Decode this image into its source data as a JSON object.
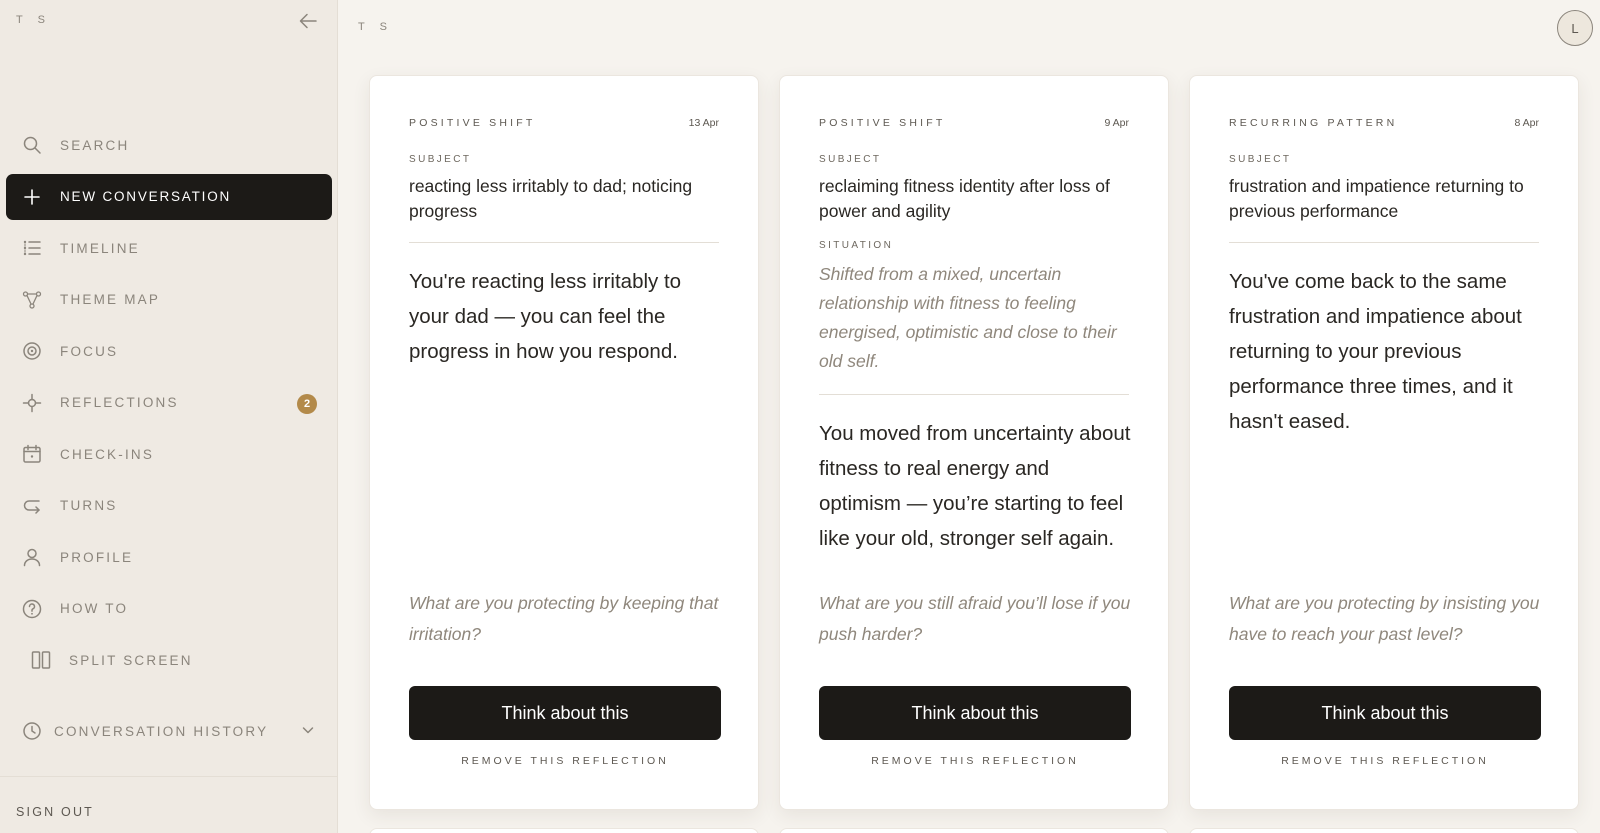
{
  "sidebar": {
    "brand": "T S",
    "collapse_icon": "arrow-left-icon",
    "items": [
      {
        "label": "SEARCH",
        "icon": "search-icon"
      },
      {
        "label": "NEW CONVERSATION",
        "icon": "plus-icon",
        "active": true
      },
      {
        "label": "TIMELINE",
        "icon": "list-icon"
      },
      {
        "label": "THEME MAP",
        "icon": "network-icon"
      },
      {
        "label": "FOCUS",
        "icon": "target-icon"
      },
      {
        "label": "REFLECTIONS",
        "icon": "crosshair-icon",
        "badge": "2"
      },
      {
        "label": "CHECK-INS",
        "icon": "calendar-icon"
      },
      {
        "label": "TURNS",
        "icon": "return-arrow-icon"
      },
      {
        "label": "PROFILE",
        "icon": "user-icon"
      },
      {
        "label": "HOW TO",
        "icon": "help-circle-icon"
      },
      {
        "label": "SPLIT SCREEN",
        "icon": "split-columns-icon"
      }
    ],
    "history_label": "CONVERSATION HISTORY",
    "sign_out": "SIGN OUT"
  },
  "header": {
    "brand": "T S",
    "avatar_initial": "L"
  },
  "cards": [
    {
      "kind": "POSITIVE SHIFT",
      "date": "13 Apr",
      "subject_label": "SUBJECT",
      "subject": "reacting less irritably to dad; noticing progress",
      "reflection": "You're reacting less irritably to your dad — you can feel the progress in how you respond.",
      "question": "What are you protecting by keeping that irritation?",
      "button": "Think about this",
      "remove": "REMOVE THIS REFLECTION"
    },
    {
      "kind": "POSITIVE SHIFT",
      "date": "9 Apr",
      "subject_label": "SUBJECT",
      "subject": "reclaiming fitness identity after loss of power and agility",
      "situation_label": "SITUATION",
      "situation": "Shifted from a mixed, uncertain relationship with fitness to feeling energised, optimistic and close to their old self.",
      "reflection": "You moved from uncertainty about fitness to real energy and optimism — you’re starting to feel like your old, stronger self again.",
      "question": "What are you still afraid you’ll lose if you push harder?",
      "button": "Think about this",
      "remove": "REMOVE THIS REFLECTION"
    },
    {
      "kind": "RECURRING PATTERN",
      "date": "8 Apr",
      "subject_label": "SUBJECT",
      "subject": "frustration and impatience returning to previous performance",
      "reflection": "You've come back to the same frustration and impatience about returning to your previous performance three times, and it hasn't eased.",
      "question": "What are you protecting by insisting you have to reach your past level?",
      "button": "Think about this",
      "remove": "REMOVE THIS REFLECTION"
    }
  ],
  "colors": {
    "accent_dark": "#1c1a17",
    "badge": "#b38a4a",
    "sidebar_bg": "#efeae3",
    "page_bg": "#f6f3ee"
  }
}
